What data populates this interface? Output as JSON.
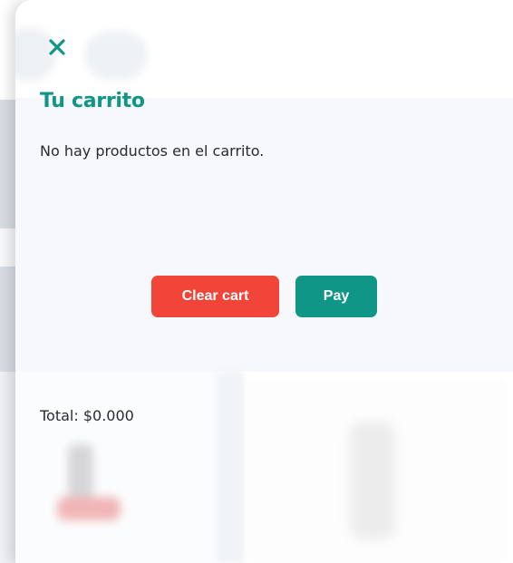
{
  "cart": {
    "title": "Tu carrito",
    "empty_message": "No hay productos en el carrito.",
    "close_icon": "close-icon",
    "clear_label": "Clear cart",
    "pay_label": "Pay",
    "total_text": "Total: $0.000"
  },
  "colors": {
    "accent_teal": "#0f9686",
    "danger_red": "#f2453a",
    "text_dark": "#262b33",
    "panel_bg": "#f7f8fb"
  }
}
